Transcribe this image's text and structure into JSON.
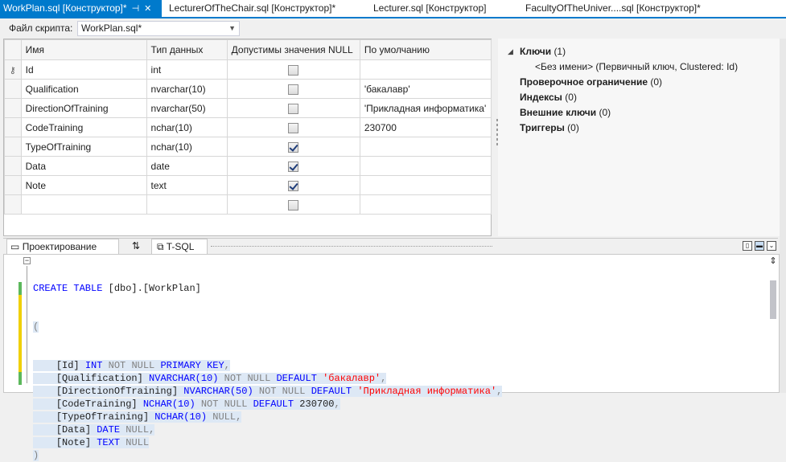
{
  "tabs": [
    {
      "label": "WorkPlan.sql [Конструктор]*",
      "active": true
    },
    {
      "label": "LecturerOfTheChair.sql [Конструктор]*",
      "active": false
    },
    {
      "label": "Lecturer.sql [Конструктор]",
      "active": false
    },
    {
      "label": "FacultyOfTheUniver....sql [Конструктор]*",
      "active": false
    }
  ],
  "script_file": {
    "label": "Файл скрипта:",
    "value": "WorkPlan.sql*"
  },
  "grid": {
    "headers": [
      "Имя",
      "Тип данных",
      "Допустимы значения NULL",
      "По умолчанию"
    ],
    "rows": [
      {
        "key": true,
        "name": "Id",
        "type": "int",
        "nullable": false,
        "default": ""
      },
      {
        "key": false,
        "name": "Qualification",
        "type": "nvarchar(10)",
        "nullable": false,
        "default": "'бакалавр'"
      },
      {
        "key": false,
        "name": "DirectionOfTraining",
        "type": "nvarchar(50)",
        "nullable": false,
        "default": "'Прикладная информатика'"
      },
      {
        "key": false,
        "name": "CodeTraining",
        "type": "nchar(10)",
        "nullable": false,
        "default": "230700"
      },
      {
        "key": false,
        "name": "TypeOfTraining",
        "type": "nchar(10)",
        "nullable": true,
        "default": ""
      },
      {
        "key": false,
        "name": "Data",
        "type": "date",
        "nullable": true,
        "default": ""
      },
      {
        "key": false,
        "name": "Note",
        "type": "text",
        "nullable": true,
        "default": ""
      },
      {
        "key": false,
        "name": "",
        "type": "",
        "nullable": false,
        "default": ""
      }
    ]
  },
  "props": {
    "keys_label": "Ключи",
    "keys_count": "(1)",
    "key_item": "<Без имени>  (Первичный ключ, Clustered: Id)",
    "check_label": "Проверочное ограничение",
    "check_count": "(0)",
    "indexes_label": "Индексы",
    "indexes_count": "(0)",
    "fk_label": "Внешние ключи",
    "fk_count": "(0)",
    "triggers_label": "Триггеры",
    "triggers_count": "(0)"
  },
  "bottom_tabs": {
    "design": "Проектирование",
    "swap": "⇅",
    "tsql": "T-SQL"
  },
  "code": {
    "create": "CREATE TABLE",
    "table": "[dbo].[WorkPlan]",
    "open": "(",
    "close": ")",
    "lines": [
      {
        "col": "[Id]",
        "type": "INT",
        "nn": "NOT NULL",
        "extra_kw": "PRIMARY KEY",
        "def": "",
        "defcls": "",
        "end": ","
      },
      {
        "col": "[Qualification]",
        "type": "NVARCHAR(10)",
        "nn": "NOT NULL",
        "extra_kw": "DEFAULT",
        "def": "'бакалавр'",
        "defcls": "st",
        "end": ","
      },
      {
        "col": "[DirectionOfTraining]",
        "type": "NVARCHAR(50)",
        "nn": "NOT NULL",
        "extra_kw": "DEFAULT",
        "def": "'Прикладная информатика'",
        "defcls": "st",
        "end": ","
      },
      {
        "col": "[CodeTraining]",
        "type": "NCHAR(10)",
        "nn": "NOT NULL",
        "extra_kw": "DEFAULT",
        "def": "230700",
        "defcls": "tx",
        "end": ","
      },
      {
        "col": "[TypeOfTraining]",
        "type": "NCHAR(10)",
        "nn": "NULL",
        "extra_kw": "",
        "def": "",
        "defcls": "",
        "end": ","
      },
      {
        "col": "[Data]",
        "type": "DATE",
        "nn": "NULL",
        "extra_kw": "",
        "def": "",
        "defcls": "",
        "end": ","
      },
      {
        "col": "[Note]",
        "type": "TEXT",
        "nn": "NULL",
        "extra_kw": "",
        "def": "",
        "defcls": "",
        "end": ""
      }
    ]
  },
  "colors": {
    "accent": "#007acc",
    "keyword": "#0000ff",
    "string": "#ff0000",
    "comment": "#808080",
    "change_green": "#5cb85c",
    "change_yellow": "#f0d000"
  }
}
